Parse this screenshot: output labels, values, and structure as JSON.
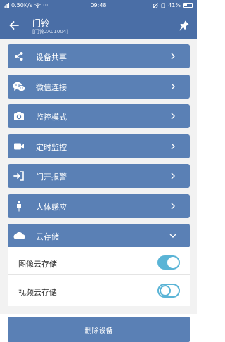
{
  "status_bar": {
    "network_speed": "0.50K/s",
    "time": "09:48",
    "battery": "41%",
    "battery_level": 0.41
  },
  "header": {
    "title": "门铃",
    "subtitle": "[门铃2A01004]"
  },
  "menu": {
    "items": [
      {
        "label": "设备共享",
        "icon": "share-icon"
      },
      {
        "label": "微信连接",
        "icon": "wechat-icon"
      },
      {
        "label": "监控模式",
        "icon": "camera-icon"
      },
      {
        "label": "定时监控",
        "icon": "video-camera-icon"
      },
      {
        "label": "门开报警",
        "icon": "door-enter-icon"
      },
      {
        "label": "人体感应",
        "icon": "person-icon"
      },
      {
        "label": "云存储",
        "icon": "cloud-icon"
      }
    ]
  },
  "cloud_storage": {
    "image_label": "图像云存储",
    "image_enabled": true,
    "video_label": "视频云存储",
    "video_enabled": false
  },
  "footer": {
    "delete_label": "删除设备"
  },
  "colors": {
    "header_bg": "#4a6ea6",
    "row_bg": "#5a80b5",
    "toggle_accent": "#5ab4d6"
  }
}
